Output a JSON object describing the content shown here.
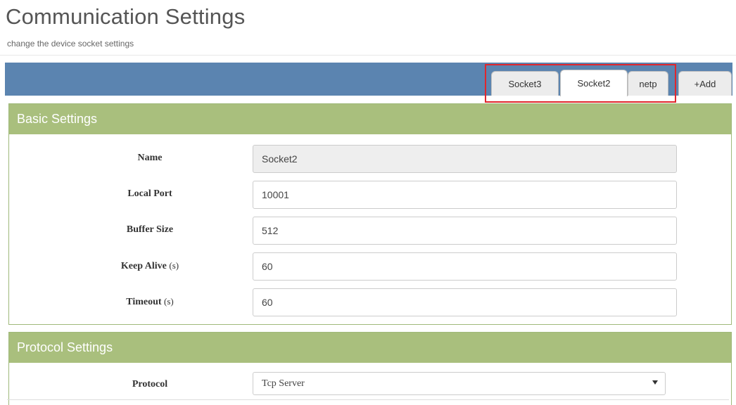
{
  "header": {
    "title": "Communication Settings",
    "subtitle": "change the device socket settings"
  },
  "tabs": [
    {
      "label": "Socket3",
      "active": false
    },
    {
      "label": "Socket2",
      "active": true
    },
    {
      "label": "netp",
      "active": false
    },
    {
      "label": "+Add",
      "active": false
    }
  ],
  "basic_settings": {
    "heading": "Basic Settings",
    "fields": {
      "name": {
        "label": "Name",
        "value": "Socket2"
      },
      "local_port": {
        "label": "Local Port",
        "value": "10001"
      },
      "buffer_size": {
        "label": "Buffer Size",
        "value": "512"
      },
      "keep_alive": {
        "label": "Keep Alive",
        "unit": "(s)",
        "value": "60"
      },
      "timeout": {
        "label": "Timeout",
        "unit": "(s)",
        "value": "60"
      }
    }
  },
  "protocol_settings": {
    "heading": "Protocol Settings",
    "protocol": {
      "label": "Protocol",
      "value": "Tcp Server"
    }
  },
  "colors": {
    "tabbar": "#5b84b0",
    "panel_header": "#a9bf7d",
    "highlight": "#e0262c"
  }
}
